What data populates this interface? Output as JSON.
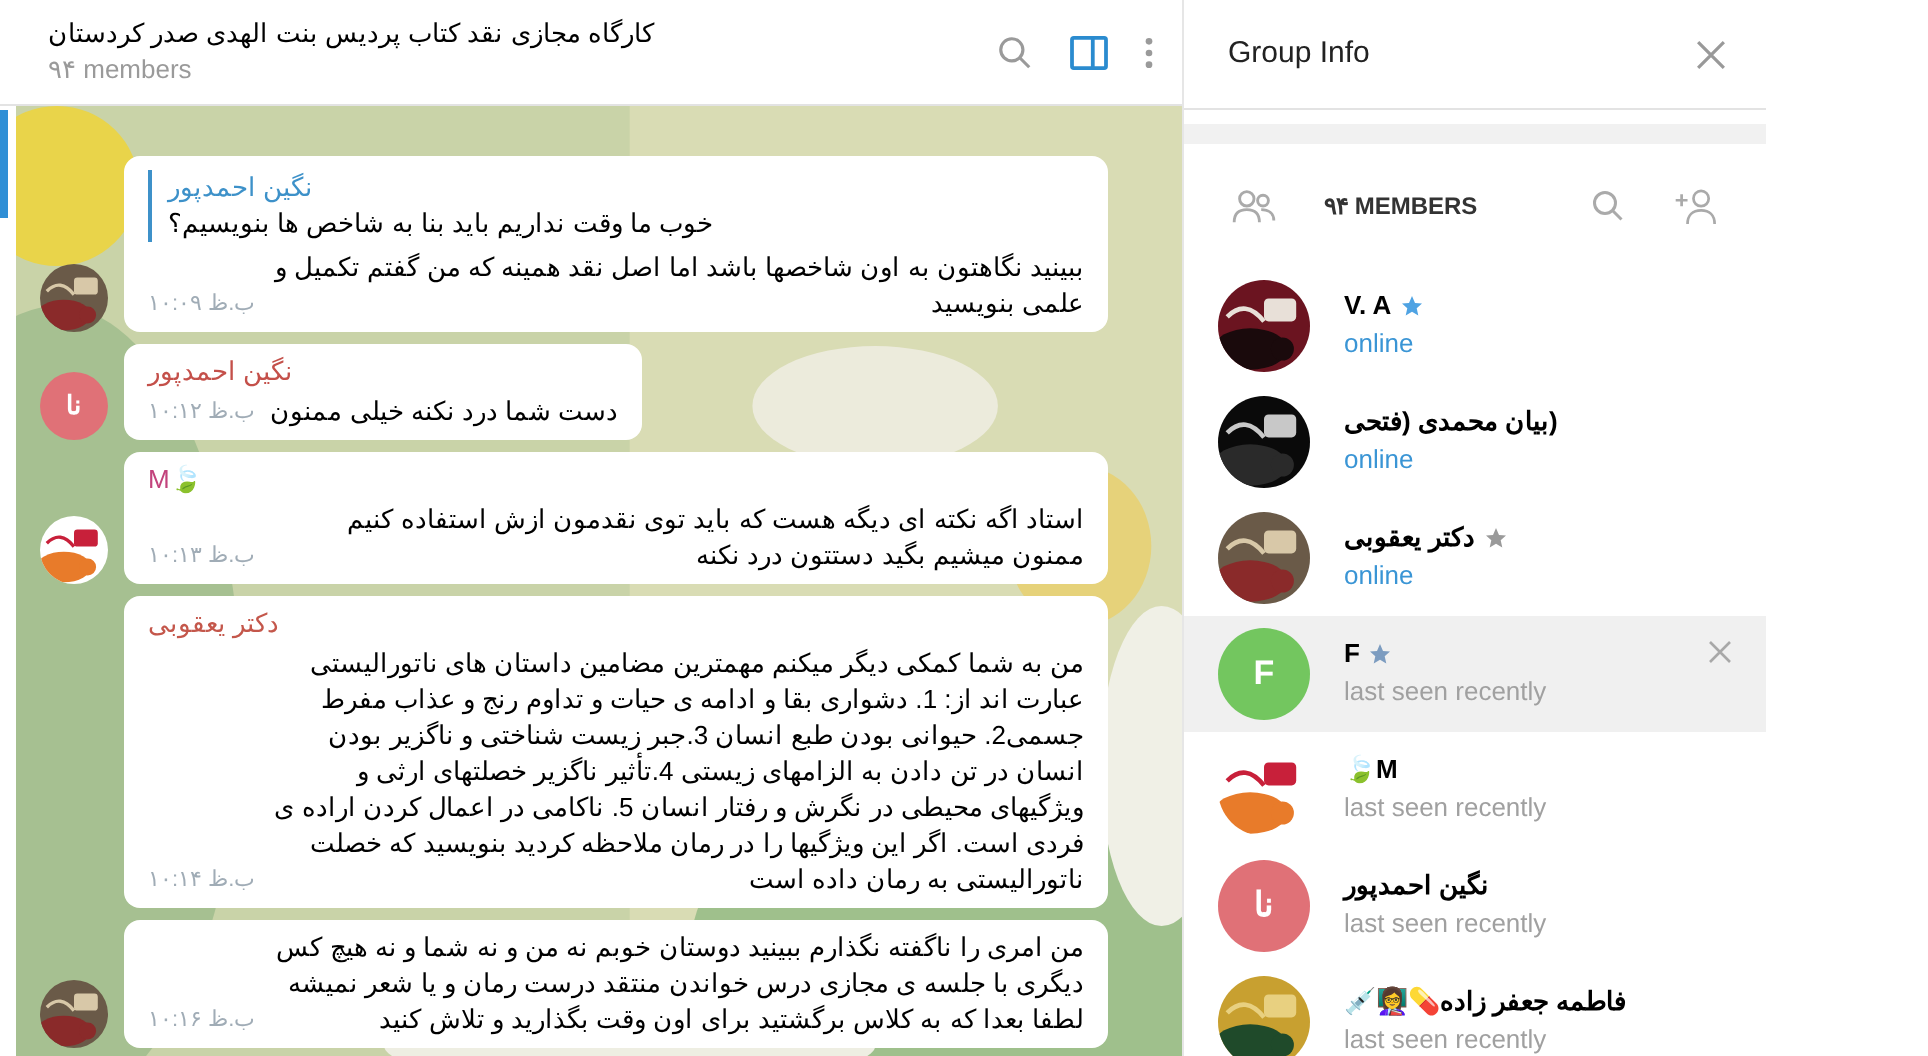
{
  "chat_header": {
    "title": "کارگاه مجازی نقد کتاب پردیس بنت الهدی صدر کردستان",
    "subtitle": "۹۴ members",
    "panel_button_selected": true
  },
  "messages": [
    {
      "reply": {
        "name": "نگین احمدپور",
        "text": "خوب ما وقت نداریم باید بنا به شاخص ها بنویسیم؟"
      },
      "text": "ببینید نگاهتون به اون شاخصها باشد اما اصل نقد همینه که من گفتم تکمیل و علمی بنویسید",
      "time": "ب.ظ ۱۰:۰۹"
    },
    {
      "sender": {
        "name": "نگین احمدپور",
        "color": "#c4504a"
      },
      "text": "دست شما درد نکنه خیلی ممنون",
      "time": "ب.ظ ۱۰:۱۲",
      "avatar": {
        "kind": "initials",
        "initials": "نا",
        "color": "#e07177"
      }
    },
    {
      "sender": {
        "name": "M🍃",
        "color": "#c2437c"
      },
      "text": "استاد اگه نکته ای دیگه هست که باید توی نقدمون ازش استفاده کنیم ممنون میشیم بگید دستتون درد نکنه",
      "time": "ب.ظ ۱۰:۱۳"
    },
    {
      "sender": {
        "name": "دکتر یعقوبی",
        "color": "#c4574b"
      },
      "text": "من به شما کمکی دیگر میکنم مهمترین مضامین داستان های ناتورالیستی عبارت اند از: 1. دشواری بقا و ادامه ی حیات و تداوم رنج و عذاب مفرط جسمی2. حیوانی بودن طبع انسان 3.جبر زیست شناختی و ناگزیر بودن انسان در تن دادن به الزامهای زیستی 4.تأثیر ناگزیر خصلتهای ارثی و ویژگیهای محیطی در نگرش و رفتار انسان 5. ناکامی در اعمال کردن اراده ی فردی است. اگر این ویژگیها را در رمان ملاحظه کردید بنویسید که خصلت ناتورالیستی به رمان داده است",
      "time": "ب.ظ ۱۰:۱۴"
    },
    {
      "text": "من امری را ناگفته نگذارم ببینید دوستان خوبم نه من و نه شما و نه هیچ کس دیگری با جلسه ی مجازی درس خواندن منتقد درست رمان و یا شعر نمیشه لطفا بعدا که به کلاس برگشتید برای اون وقت بگذارید و تلاش کنید",
      "time": "ب.ظ ۱۰:۱۶"
    }
  ],
  "info_panel": {
    "title": "Group Info",
    "members_count": "۹۴ MEMBERS",
    "members": [
      {
        "name": "V. A",
        "star": {
          "color": "#4fa3e3"
        },
        "online": true,
        "status": "online",
        "hovered": false
      },
      {
        "name": "(بیان محمدی (فتحی",
        "online": true,
        "status": "online",
        "hovered": false
      },
      {
        "name": "دکتر یعقوبی",
        "star": {
          "color": "#9a9a9a"
        },
        "online": true,
        "status": "online",
        "hovered": false
      },
      {
        "name": "F",
        "star": {
          "color": "#7c9cc0"
        },
        "online": false,
        "status": "last seen recently",
        "hovered": true,
        "avatar": {
          "kind": "initials",
          "initials": "F",
          "color": "#73c65f"
        }
      },
      {
        "name": "M🍃",
        "online": false,
        "status": "last seen recently",
        "hovered": false
      },
      {
        "name": "نگین احمدپور",
        "online": false,
        "status": "last seen recently",
        "hovered": false,
        "avatar": {
          "kind": "initials",
          "initials": "نا",
          "color": "#e07177"
        }
      },
      {
        "name": "فاطمه جعفر زاده💊👩‍🏫💉",
        "online": false,
        "status": "last seen recently",
        "hovered": false
      }
    ]
  }
}
